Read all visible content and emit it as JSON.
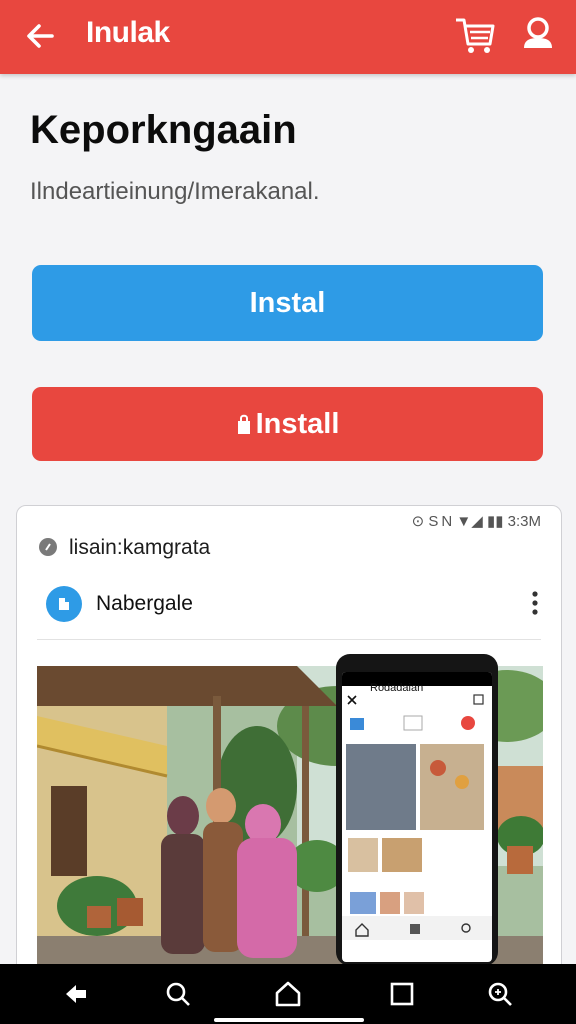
{
  "appbar": {
    "title": "Inulak",
    "back_icon": "arrow-left-icon",
    "cart_icon": "shopping-cart-icon",
    "account_icon": "user-icon"
  },
  "page": {
    "title": "Keporkngaain",
    "subtitle": "Ilndeartieinung/Imerakanal."
  },
  "buttons": {
    "primary_label": "Instal",
    "secondary_label": "Install"
  },
  "card": {
    "status_bar": "⊙ S N ▼◢ ▮▮ 3:3M",
    "title": "lisain:kamgrata",
    "brand_name": "Nabergale",
    "phone_title": "Rodadaian"
  },
  "colors": {
    "appbar": "#e8473f",
    "primary_button": "#2e9be6",
    "secondary_button": "#e8473f",
    "navbar": "#000000"
  },
  "navbar": {
    "icons": [
      "back-icon",
      "search-icon",
      "home-icon",
      "recents-icon",
      "zoom-icon"
    ]
  }
}
